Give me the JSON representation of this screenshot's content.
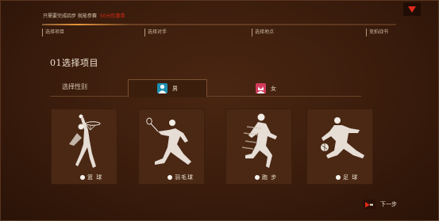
{
  "header": {
    "notice_text": "只需要完成四步 就能参赛",
    "notice_highlight": "50元优惠券"
  },
  "steps": [
    {
      "label": "选择项目"
    },
    {
      "label": "选择对手"
    },
    {
      "label": "选择地点"
    },
    {
      "label": "竞拍战书"
    }
  ],
  "section": {
    "title": "01选择项目",
    "gender_label": "选择性别",
    "genders": [
      {
        "label": "男",
        "icon": "male-icon",
        "selected": true
      },
      {
        "label": "女",
        "icon": "female-icon",
        "selected": false
      }
    ]
  },
  "sports": [
    {
      "label": "篮 球",
      "icon": "basketball-player-icon"
    },
    {
      "label": "羽毛球",
      "icon": "badminton-player-icon"
    },
    {
      "label": "跑 步",
      "icon": "runner-icon"
    },
    {
      "label": "足 球",
      "icon": "soccer-player-icon"
    }
  ],
  "footer": {
    "next_label": "下一步"
  },
  "colors": {
    "accent_red": "#e02a1a",
    "male_blue": "#1d8fb0",
    "female_pink": "#d23a5a"
  }
}
